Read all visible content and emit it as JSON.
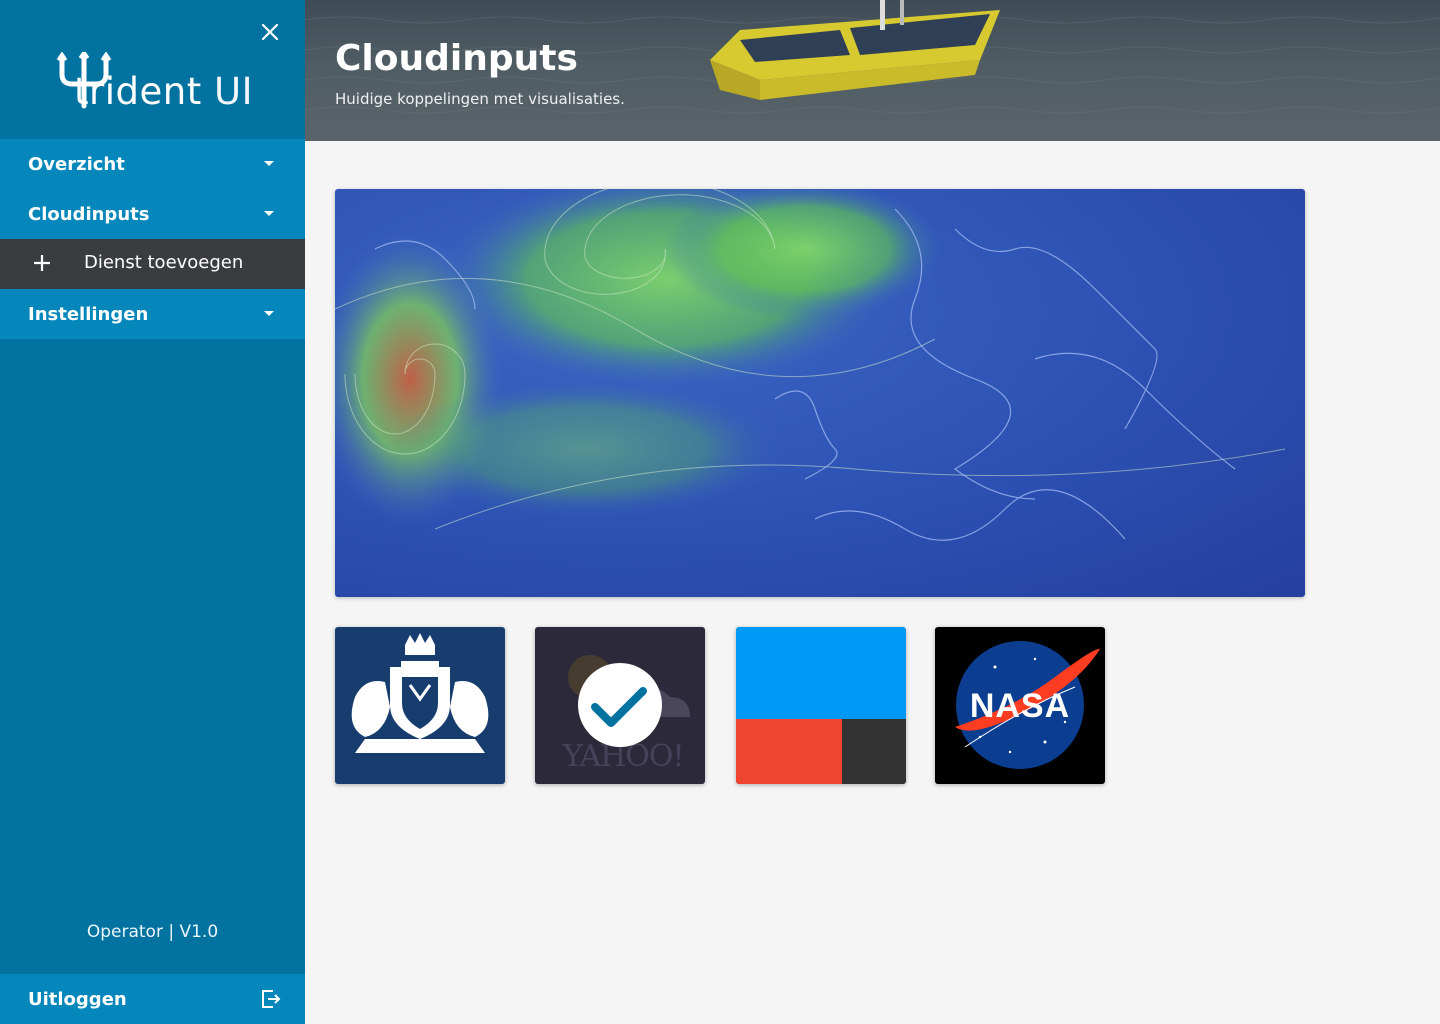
{
  "sidebar": {
    "logo": {
      "brand": "trident",
      "suffix": "UI"
    },
    "items": [
      {
        "label": "Overzicht"
      },
      {
        "label": "Cloudinputs"
      },
      {
        "label": "Instellingen"
      }
    ],
    "sub_item": {
      "label": "Dienst toevoegen"
    },
    "version": "Operator | V1.0",
    "logout_label": "Uitloggen"
  },
  "header": {
    "title": "Cloudinputs",
    "subtitle": "Huidige koppelingen met visualisaties."
  },
  "main": {
    "map": {
      "type": "wind-visualisation"
    },
    "tiles": [
      {
        "name": "rijksoverheid",
        "color": "#163d6e"
      },
      {
        "name": "yahoo-weather",
        "color": "#2c2a3a",
        "text": "YAHOO!",
        "selected": true
      },
      {
        "name": "three-color-service",
        "colors": [
          "#0099f7",
          "#ef4430",
          "#333333"
        ]
      },
      {
        "name": "nasa",
        "color": "#000000",
        "text": "NASA"
      }
    ]
  },
  "colors": {
    "sidebar": "#0273a0",
    "nav_item": "#0587bb",
    "sub_item": "#393d40",
    "background": "#f5f5f5"
  }
}
